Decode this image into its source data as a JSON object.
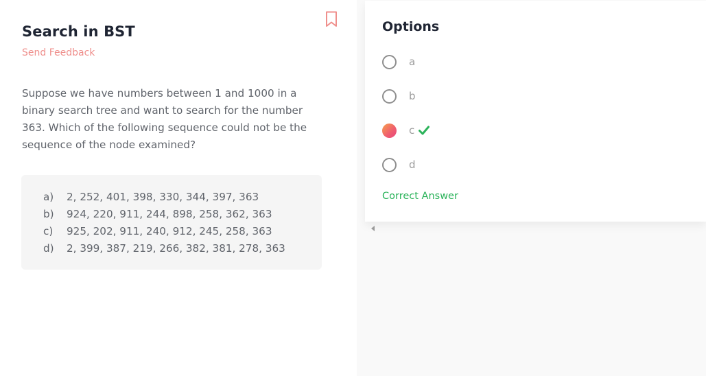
{
  "question": {
    "title": "Search in BST",
    "feedback_label": "Send Feedback",
    "text": "Suppose we have numbers between 1 and 1000 in a binary search tree and want to search for the number 363. Which of the following sequence could not be the sequence of the node examined?",
    "sequences": [
      {
        "letter": "a)",
        "values": "2, 252, 401, 398, 330, 344, 397, 363"
      },
      {
        "letter": "b)",
        "values": "924, 220, 911, 244, 898, 258, 362, 363"
      },
      {
        "letter": "c)",
        "values": "925, 202, 911, 240, 912, 245, 258, 363"
      },
      {
        "letter": "d)",
        "values": "2, 399, 387, 219, 266, 382, 381, 278, 363"
      }
    ],
    "bookmark_icon": "bookmark-icon"
  },
  "options": {
    "title": "Options",
    "items": [
      {
        "label": "a",
        "selected": false
      },
      {
        "label": "b",
        "selected": false
      },
      {
        "label": "c",
        "selected": true,
        "correct": true
      },
      {
        "label": "d",
        "selected": false
      }
    ],
    "result_text": "Correct Answer"
  },
  "colors": {
    "accent_pink": "#ef8f8c",
    "correct_green": "#2bb35a",
    "title_dark": "#1f2533"
  }
}
